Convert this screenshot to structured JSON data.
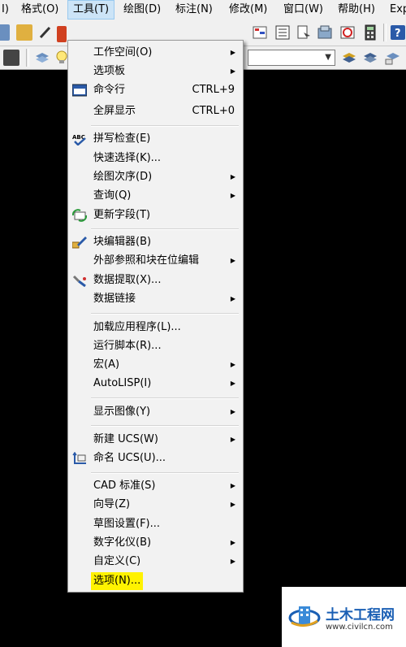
{
  "menubar": {
    "items": [
      "I)",
      "格式(O)",
      "工具(T)",
      "绘图(D)",
      "标注(N)",
      "修改(M)",
      "窗口(W)",
      "帮助(H)",
      "Exp"
    ]
  },
  "menu": {
    "items": [
      {
        "label": "工作空间(O)",
        "shortcut": "",
        "submenu": true
      },
      {
        "label": "选项板",
        "shortcut": "",
        "submenu": true
      },
      {
        "label": "命令行",
        "shortcut": "CTRL+9",
        "submenu": false,
        "icon": "command-line-icon"
      },
      {
        "label": "全屏显示",
        "shortcut": "CTRL+0",
        "submenu": false
      },
      {
        "label": "拼写检查(E)",
        "shortcut": "",
        "submenu": false,
        "icon": "spell-check-icon"
      },
      {
        "label": "快速选择(K)...",
        "shortcut": "",
        "submenu": false
      },
      {
        "label": "绘图次序(D)",
        "shortcut": "",
        "submenu": true
      },
      {
        "label": "查询(Q)",
        "shortcut": "",
        "submenu": true
      },
      {
        "label": "更新字段(T)",
        "shortcut": "",
        "submenu": false,
        "icon": "update-field-icon"
      },
      {
        "label": "块编辑器(B)",
        "shortcut": "",
        "submenu": false,
        "icon": "block-editor-icon"
      },
      {
        "label": "外部参照和块在位编辑",
        "shortcut": "",
        "submenu": true
      },
      {
        "label": "数据提取(X)...",
        "shortcut": "",
        "submenu": false,
        "icon": "data-extraction-icon"
      },
      {
        "label": "数据链接",
        "shortcut": "",
        "submenu": true
      },
      {
        "label": "加载应用程序(L)...",
        "shortcut": "",
        "submenu": false
      },
      {
        "label": "运行脚本(R)...",
        "shortcut": "",
        "submenu": false
      },
      {
        "label": "宏(A)",
        "shortcut": "",
        "submenu": true
      },
      {
        "label": "AutoLISP(I)",
        "shortcut": "",
        "submenu": true
      },
      {
        "label": "显示图像(Y)",
        "shortcut": "",
        "submenu": true
      },
      {
        "label": "新建 UCS(W)",
        "shortcut": "",
        "submenu": true
      },
      {
        "label": "命名 UCS(U)...",
        "shortcut": "",
        "submenu": false,
        "icon": "named-ucs-icon"
      },
      {
        "label": "CAD 标准(S)",
        "shortcut": "",
        "submenu": true
      },
      {
        "label": "向导(Z)",
        "shortcut": "",
        "submenu": true
      },
      {
        "label": "草图设置(F)...",
        "shortcut": "",
        "submenu": false
      },
      {
        "label": "数字化仪(B)",
        "shortcut": "",
        "submenu": true
      },
      {
        "label": "自定义(C)",
        "shortcut": "",
        "submenu": true
      },
      {
        "label": "选项(N)...",
        "shortcut": "",
        "submenu": false,
        "highlighted": true
      }
    ],
    "submenu_arrow": "▶",
    "spell_icon_text": "ABC"
  },
  "watermark": {
    "title": "土木工程网",
    "url": "www.civilcn.com"
  },
  "colors": {
    "highlight": "#fff200",
    "menu_bg": "#f2f2f2",
    "active_menu": "#cce4f7",
    "canvas": "#000000",
    "brand": "#1a5fb4"
  }
}
